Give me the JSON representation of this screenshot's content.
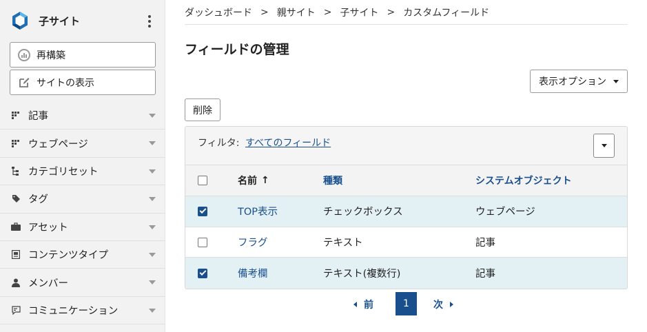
{
  "sidebar": {
    "site_name": "子サイト",
    "rebuild_label": "再構築",
    "view_site_label": "サイトの表示",
    "nav": [
      {
        "label": "記事",
        "icon": "entries-icon"
      },
      {
        "label": "ウェブページ",
        "icon": "pages-icon"
      },
      {
        "label": "カテゴリセット",
        "icon": "category-set-icon"
      },
      {
        "label": "タグ",
        "icon": "tag-icon"
      },
      {
        "label": "アセット",
        "icon": "asset-icon"
      },
      {
        "label": "コンテンツタイプ",
        "icon": "content-type-icon"
      },
      {
        "label": "メンバー",
        "icon": "member-icon"
      },
      {
        "label": "コミュニケーション",
        "icon": "communication-icon"
      }
    ]
  },
  "breadcrumb": [
    "ダッシュボード",
    "親サイト",
    "子サイト",
    "カスタムフィールド"
  ],
  "breadcrumb_sep": ">",
  "page_title": "フィールドの管理",
  "display_options_label": "表示オプション",
  "delete_label": "削除",
  "filter": {
    "label": "フィルタ:",
    "value": "すべてのフィールド"
  },
  "table": {
    "headers": {
      "name": "名前",
      "sort_arrow": "↑",
      "type": "種類",
      "system_object": "システムオブジェクト"
    },
    "rows": [
      {
        "checked": true,
        "name": "TOP表示",
        "type": "チェックボックス",
        "object": "ウェブページ"
      },
      {
        "checked": false,
        "name": "フラグ",
        "type": "テキスト",
        "object": "記事"
      },
      {
        "checked": true,
        "name": "備考欄",
        "type": "テキスト(複数行)",
        "object": "記事"
      }
    ]
  },
  "pager": {
    "prev": "前",
    "current": "1",
    "next": "次"
  },
  "colors": {
    "accent": "#1a4f8e",
    "selected_row": "#e3f1f5",
    "sidebar_bg": "#f2f2f2"
  }
}
